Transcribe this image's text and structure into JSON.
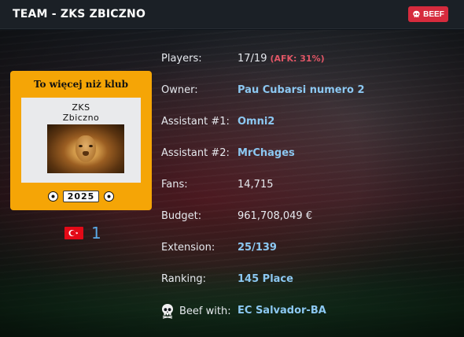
{
  "header": {
    "title": "TEAM - ZKS ZBICZNO",
    "badge_label": "BEEF"
  },
  "logo": {
    "motto": "To więcej niż klub",
    "name_line1": "ZKS",
    "name_line2": "Zbiczno",
    "year": "2025"
  },
  "country": {
    "flag": "turkey-flag",
    "rank": "1"
  },
  "info": {
    "players_label": "Players:",
    "players_value": "17/19",
    "players_afk": "(AFK: 31%)",
    "owner_label": "Owner:",
    "owner_value": "Pau Cubarsi numero 2",
    "assistant1_label": "Assistant #1:",
    "assistant1_value": "Omni2",
    "assistant2_label": "Assistant #2:",
    "assistant2_value": "MrChages",
    "fans_label": "Fans:",
    "fans_value": "14,715",
    "budget_label": "Budget:",
    "budget_value": "961,708,049 €",
    "extension_label": "Extension:",
    "extension_value": "25/139",
    "ranking_label": "Ranking:",
    "ranking_value": "145 Place",
    "beef_label": "Beef with:",
    "beef_value": "EC Salvador-BA"
  },
  "colors": {
    "accent_link": "#8cc8f2",
    "badge_red": "#d62b3d",
    "afk_red": "#e05666",
    "rank_blue": "#5aa9e6"
  }
}
